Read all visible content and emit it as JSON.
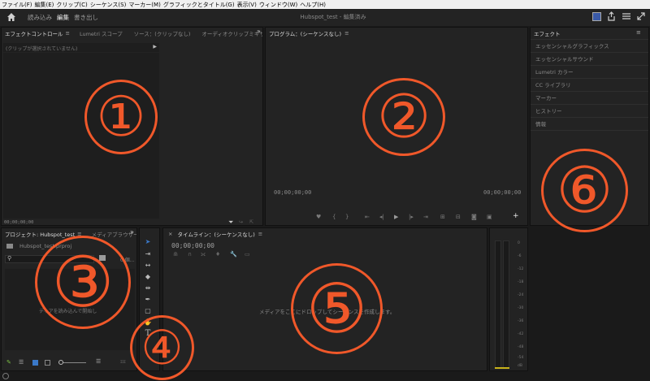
{
  "menubar": [
    "ファイル(F)",
    "編集(E)",
    "クリップ(C)",
    "シーケンス(S)",
    "マーカー(M)",
    "グラフィックとタイトル(G)",
    "表示(V)",
    "ウィンドウ(W)",
    "ヘルプ(H)"
  ],
  "workspace": {
    "tabs": [
      "読み込み",
      "編集",
      "書き出し"
    ],
    "title": "Hubspot_test - 編集済み"
  },
  "effect_controls": {
    "tabs": [
      "エフェクトコントロール",
      "Lumetri スコープ",
      "ソース：(クリップなし)",
      "オーディオクリップミキサー："
    ],
    "no_clip": "(クリップが選択されていません)",
    "timecode": "00;00;00;00"
  },
  "program": {
    "title": "プログラム：(シーケンスなし)",
    "tc_left": "00;00;00;00",
    "tc_right": "00;00;00;00"
  },
  "effects_panel": {
    "title": "エフェクト",
    "items": [
      "エッセンシャルグラフィックス",
      "エッセンシャルサウンド",
      "Lumetri カラー",
      "CC ライブラリ",
      "マーカー",
      "ヒストリー",
      "情報"
    ]
  },
  "project": {
    "tabs": [
      "プロジェクト: Hubspot_test",
      "メディアブラウザー"
    ],
    "file": "Hubspot_test.prproj",
    "count": "0 個...",
    "hint": "ディアを読み込んで開始し",
    "tool_dots": "ɪɪɪ"
  },
  "timeline": {
    "title": "タイムライン：(シーケンスなし)",
    "timecode": "00;00;00;00",
    "drop_hint": "メディアをここにドロップしてシーケンスを作成します。"
  },
  "meter": {
    "labels": [
      "0",
      "-6",
      "-12",
      "-18",
      "-24",
      "-30",
      "-36",
      "-42",
      "-48",
      "-54",
      "dB"
    ]
  },
  "annotations": [
    "①",
    "②",
    "③",
    "④",
    "⑤",
    "⑥"
  ],
  "colors": {
    "accent": "#f0582a",
    "bg": "#232323"
  }
}
